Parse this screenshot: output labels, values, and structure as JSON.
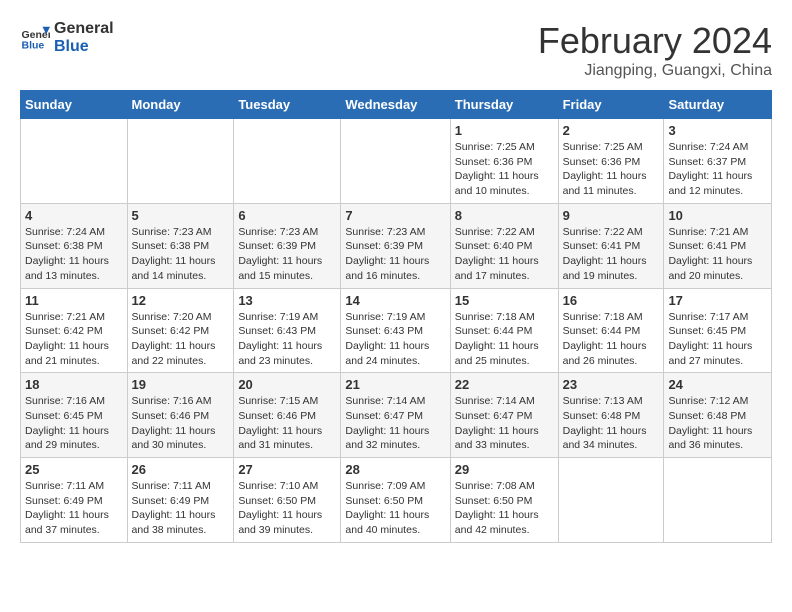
{
  "header": {
    "logo_general": "General",
    "logo_blue": "Blue",
    "title": "February 2024",
    "subtitle": "Jiangping, Guangxi, China"
  },
  "weekdays": [
    "Sunday",
    "Monday",
    "Tuesday",
    "Wednesday",
    "Thursday",
    "Friday",
    "Saturday"
  ],
  "weeks": [
    [
      {
        "day": "",
        "info": ""
      },
      {
        "day": "",
        "info": ""
      },
      {
        "day": "",
        "info": ""
      },
      {
        "day": "",
        "info": ""
      },
      {
        "day": "1",
        "info": "Sunrise: 7:25 AM\nSunset: 6:36 PM\nDaylight: 11 hours\nand 10 minutes."
      },
      {
        "day": "2",
        "info": "Sunrise: 7:25 AM\nSunset: 6:36 PM\nDaylight: 11 hours\nand 11 minutes."
      },
      {
        "day": "3",
        "info": "Sunrise: 7:24 AM\nSunset: 6:37 PM\nDaylight: 11 hours\nand 12 minutes."
      }
    ],
    [
      {
        "day": "4",
        "info": "Sunrise: 7:24 AM\nSunset: 6:38 PM\nDaylight: 11 hours\nand 13 minutes."
      },
      {
        "day": "5",
        "info": "Sunrise: 7:23 AM\nSunset: 6:38 PM\nDaylight: 11 hours\nand 14 minutes."
      },
      {
        "day": "6",
        "info": "Sunrise: 7:23 AM\nSunset: 6:39 PM\nDaylight: 11 hours\nand 15 minutes."
      },
      {
        "day": "7",
        "info": "Sunrise: 7:23 AM\nSunset: 6:39 PM\nDaylight: 11 hours\nand 16 minutes."
      },
      {
        "day": "8",
        "info": "Sunrise: 7:22 AM\nSunset: 6:40 PM\nDaylight: 11 hours\nand 17 minutes."
      },
      {
        "day": "9",
        "info": "Sunrise: 7:22 AM\nSunset: 6:41 PM\nDaylight: 11 hours\nand 19 minutes."
      },
      {
        "day": "10",
        "info": "Sunrise: 7:21 AM\nSunset: 6:41 PM\nDaylight: 11 hours\nand 20 minutes."
      }
    ],
    [
      {
        "day": "11",
        "info": "Sunrise: 7:21 AM\nSunset: 6:42 PM\nDaylight: 11 hours\nand 21 minutes."
      },
      {
        "day": "12",
        "info": "Sunrise: 7:20 AM\nSunset: 6:42 PM\nDaylight: 11 hours\nand 22 minutes."
      },
      {
        "day": "13",
        "info": "Sunrise: 7:19 AM\nSunset: 6:43 PM\nDaylight: 11 hours\nand 23 minutes."
      },
      {
        "day": "14",
        "info": "Sunrise: 7:19 AM\nSunset: 6:43 PM\nDaylight: 11 hours\nand 24 minutes."
      },
      {
        "day": "15",
        "info": "Sunrise: 7:18 AM\nSunset: 6:44 PM\nDaylight: 11 hours\nand 25 minutes."
      },
      {
        "day": "16",
        "info": "Sunrise: 7:18 AM\nSunset: 6:44 PM\nDaylight: 11 hours\nand 26 minutes."
      },
      {
        "day": "17",
        "info": "Sunrise: 7:17 AM\nSunset: 6:45 PM\nDaylight: 11 hours\nand 27 minutes."
      }
    ],
    [
      {
        "day": "18",
        "info": "Sunrise: 7:16 AM\nSunset: 6:45 PM\nDaylight: 11 hours\nand 29 minutes."
      },
      {
        "day": "19",
        "info": "Sunrise: 7:16 AM\nSunset: 6:46 PM\nDaylight: 11 hours\nand 30 minutes."
      },
      {
        "day": "20",
        "info": "Sunrise: 7:15 AM\nSunset: 6:46 PM\nDaylight: 11 hours\nand 31 minutes."
      },
      {
        "day": "21",
        "info": "Sunrise: 7:14 AM\nSunset: 6:47 PM\nDaylight: 11 hours\nand 32 minutes."
      },
      {
        "day": "22",
        "info": "Sunrise: 7:14 AM\nSunset: 6:47 PM\nDaylight: 11 hours\nand 33 minutes."
      },
      {
        "day": "23",
        "info": "Sunrise: 7:13 AM\nSunset: 6:48 PM\nDaylight: 11 hours\nand 34 minutes."
      },
      {
        "day": "24",
        "info": "Sunrise: 7:12 AM\nSunset: 6:48 PM\nDaylight: 11 hours\nand 36 minutes."
      }
    ],
    [
      {
        "day": "25",
        "info": "Sunrise: 7:11 AM\nSunset: 6:49 PM\nDaylight: 11 hours\nand 37 minutes."
      },
      {
        "day": "26",
        "info": "Sunrise: 7:11 AM\nSunset: 6:49 PM\nDaylight: 11 hours\nand 38 minutes."
      },
      {
        "day": "27",
        "info": "Sunrise: 7:10 AM\nSunset: 6:50 PM\nDaylight: 11 hours\nand 39 minutes."
      },
      {
        "day": "28",
        "info": "Sunrise: 7:09 AM\nSunset: 6:50 PM\nDaylight: 11 hours\nand 40 minutes."
      },
      {
        "day": "29",
        "info": "Sunrise: 7:08 AM\nSunset: 6:50 PM\nDaylight: 11 hours\nand 42 minutes."
      },
      {
        "day": "",
        "info": ""
      },
      {
        "day": "",
        "info": ""
      }
    ]
  ]
}
